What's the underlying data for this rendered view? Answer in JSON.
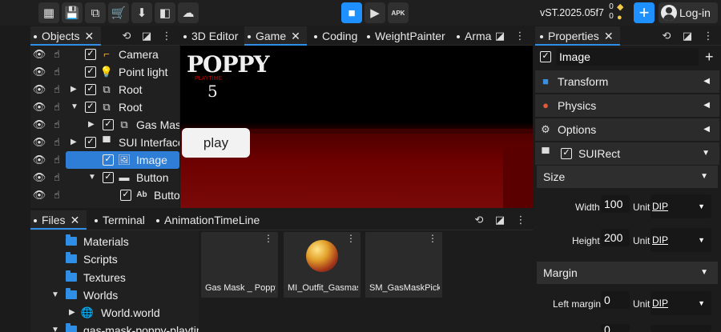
{
  "toolbar": {
    "version": "vST.2025.05f7",
    "counter_top": "0",
    "counter_bottom": "0",
    "login_label": "Log-in",
    "apk_label": "APK"
  },
  "objects_panel": {
    "tab_label": "Objects",
    "rows": [
      {
        "label": "Camera"
      },
      {
        "label": "Point light"
      },
      {
        "label": "Root"
      },
      {
        "label": "Root"
      },
      {
        "label": "Gas Mask"
      },
      {
        "label": "SUI Interface"
      },
      {
        "label": "Image"
      },
      {
        "label": "Button"
      },
      {
        "label": "Button"
      }
    ]
  },
  "center_tabs": [
    "3D Editor",
    "Game",
    "Coding",
    "WeightPainter",
    "Arma"
  ],
  "game": {
    "logo_title": "POPPY",
    "logo_sub": "PLAYTIME",
    "logo_number": "5",
    "play_label": "play"
  },
  "bottom_tabs": [
    "Files",
    "Terminal",
    "AnimationTimeLine"
  ],
  "file_tree": [
    {
      "label": "Materials"
    },
    {
      "label": "Scripts"
    },
    {
      "label": "Textures"
    },
    {
      "label": "Worlds"
    },
    {
      "label": "World.world"
    },
    {
      "label": "gas-mask-poppy-playtime"
    }
  ],
  "file_cards": [
    {
      "name": "Gas Mask _ Poppy Playtime"
    },
    {
      "name": "MI_Outfit_Gasmask"
    },
    {
      "name": "SM_GasMaskPickup"
    }
  ],
  "properties": {
    "tab_label": "Properties",
    "object_name": "Image",
    "sections": [
      {
        "label": "Transform"
      },
      {
        "label": "Physics"
      },
      {
        "label": "Options"
      },
      {
        "label": "SUIRect"
      }
    ],
    "size_label": "Size",
    "width_label": "Width",
    "width_value": "100",
    "height_label": "Height",
    "height_value": "200",
    "unit_label": "Unit",
    "unit_value": "DIP",
    "margin_label": "Margin",
    "left_margin_label": "Left margin",
    "left_margin_value": "0",
    "next_margin_value": "0"
  },
  "colors": {
    "accent": "#2f8fe6",
    "selection": "#2e7ed8",
    "play_blue": "#1e90ff",
    "floor_red": "#6d0000"
  }
}
